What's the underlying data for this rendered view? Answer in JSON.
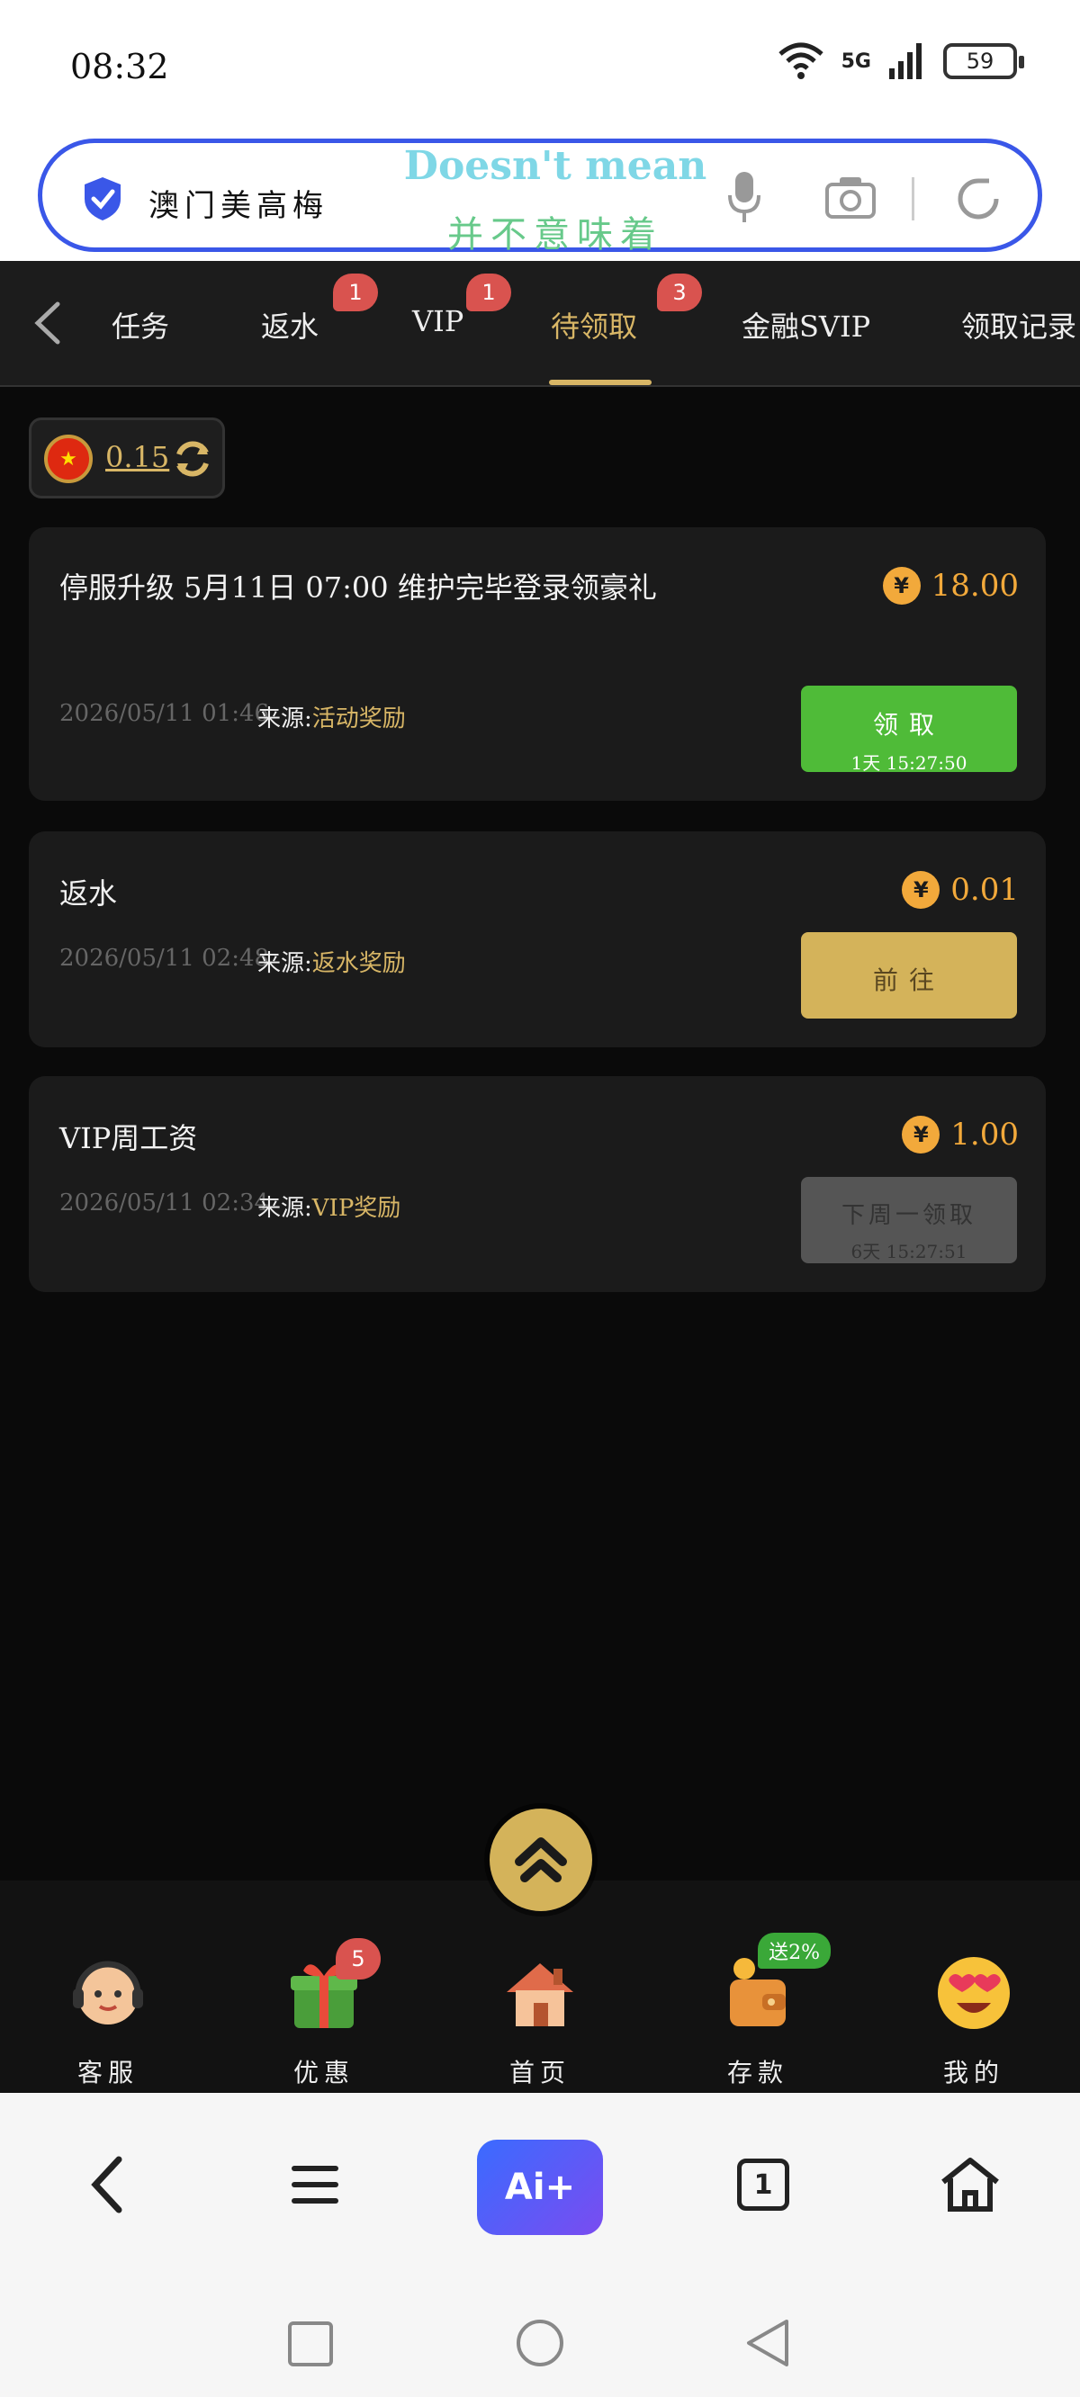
{
  "status_bar": {
    "time": "08:32",
    "network": "5G",
    "battery": "59"
  },
  "search_bar": {
    "query": "澳门美高梅",
    "overlay_en": "Doesn't mean",
    "overlay_zh": "并不意味着"
  },
  "tabs": [
    {
      "label": "任务",
      "badge": ""
    },
    {
      "label": "返水",
      "badge": "1"
    },
    {
      "label": "VIP",
      "badge": "1"
    },
    {
      "label": "待领取",
      "badge": "3",
      "active": true
    },
    {
      "label": "金融SVIP",
      "badge": ""
    },
    {
      "label": "领取记录",
      "badge": ""
    }
  ],
  "balance": {
    "value": "0.15"
  },
  "source_prefix": "来源:",
  "cards": [
    {
      "title": "停服升级 5月11日 07:00 维护完毕登录领豪礼",
      "amount": "18.00",
      "date": "2026/05/11 01:46",
      "source": "活动奖励",
      "button_label": "领取",
      "button_sub": "1天 15:27:50"
    },
    {
      "title": "返水",
      "amount": "0.01",
      "date": "2026/05/11 02:48",
      "source": "返水奖励",
      "button_label": "前往",
      "button_sub": ""
    },
    {
      "title": "VIP周工资",
      "amount": "1.00",
      "date": "2026/05/11 02:34",
      "source": "VIP奖励",
      "button_label": "下周一领取",
      "button_sub": "6天 15:27:51"
    }
  ],
  "app_nav": [
    {
      "label": "客服",
      "badge": "",
      "promo": ""
    },
    {
      "label": "优惠",
      "badge": "5",
      "promo": ""
    },
    {
      "label": "首页",
      "badge": "",
      "promo": ""
    },
    {
      "label": "存款",
      "badge": "",
      "promo": "送2%"
    },
    {
      "label": "我的",
      "badge": "",
      "promo": ""
    }
  ],
  "browser_bar": {
    "ai_label": "Ai+",
    "tab_count": "1"
  },
  "colors": {
    "accent_gold": "#d8b666",
    "amount_orange": "#f2a93b",
    "claim_green": "#4fbb38",
    "badge_red": "#d9534f",
    "search_border": "#3a57e8"
  }
}
